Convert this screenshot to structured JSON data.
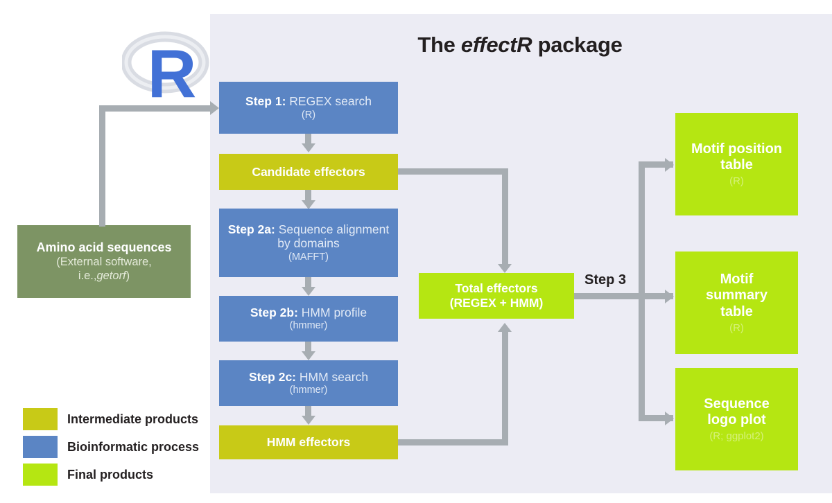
{
  "title": {
    "prefix": "The ",
    "emphasis": "effectR",
    "suffix": " package"
  },
  "logo": {
    "letter": "R",
    "name": "r-logo"
  },
  "input_box": {
    "title": "Amino acid sequences",
    "sub_line1": "(External software,",
    "sub_line2_prefix": "i.e.,",
    "sub_line2_italic": "getorf",
    "sub_line2_suffix": ")"
  },
  "pipeline": [
    {
      "id": "step1",
      "kind": "process",
      "label_strong": "Step 1:",
      "label_light": " REGEX search",
      "sub": "(R)"
    },
    {
      "id": "candidate-effectors",
      "kind": "intermediate",
      "label_strong": "Candidate effectors",
      "label_light": "",
      "sub": ""
    },
    {
      "id": "step2a",
      "kind": "process",
      "label_strong": "Step 2a:",
      "label_light": " Sequence alignment by domains",
      "sub": "(MAFFT)"
    },
    {
      "id": "step2b",
      "kind": "process",
      "label_strong": "Step 2b:",
      "label_light": " HMM profile",
      "sub": "(hmmer)"
    },
    {
      "id": "step2c",
      "kind": "process",
      "label_strong": "Step 2c:",
      "label_light": " HMM search",
      "sub": "(hmmer)"
    },
    {
      "id": "hmm-effectors",
      "kind": "intermediate",
      "label_strong": "HMM effectors",
      "label_light": "",
      "sub": ""
    }
  ],
  "total_effectors": {
    "line1": "Total effectors",
    "line2": "(REGEX + HMM)"
  },
  "step3_label": "Step 3",
  "outputs": [
    {
      "id": "motif-position-table",
      "line1": "Motif position",
      "line2": "table",
      "sub": "(R)"
    },
    {
      "id": "motif-summary-table",
      "line1": "Motif",
      "line2": "summary",
      "line3": "table",
      "sub": "(R)"
    },
    {
      "id": "sequence-logo-plot",
      "line1": "Sequence",
      "line2": "logo plot",
      "sub": "(R; ggplot2)"
    }
  ],
  "legend": [
    {
      "label": "Intermediate products",
      "color": "#c8ca17"
    },
    {
      "label": "Bioinformatic process",
      "color": "#5b85c4"
    },
    {
      "label": "Final products",
      "color": "#b5e612"
    }
  ],
  "colors": {
    "panel_background": "#ececf4",
    "process_blue": "#5b85c4",
    "intermediate_olive": "#c8ca17",
    "final_green": "#b5e612",
    "input_sage": "#7d9464",
    "connector_gray": "#a7adb2",
    "logo_blue": "#4271d6",
    "logo_ring": "#d6d9e0",
    "text_dark": "#231f20"
  }
}
